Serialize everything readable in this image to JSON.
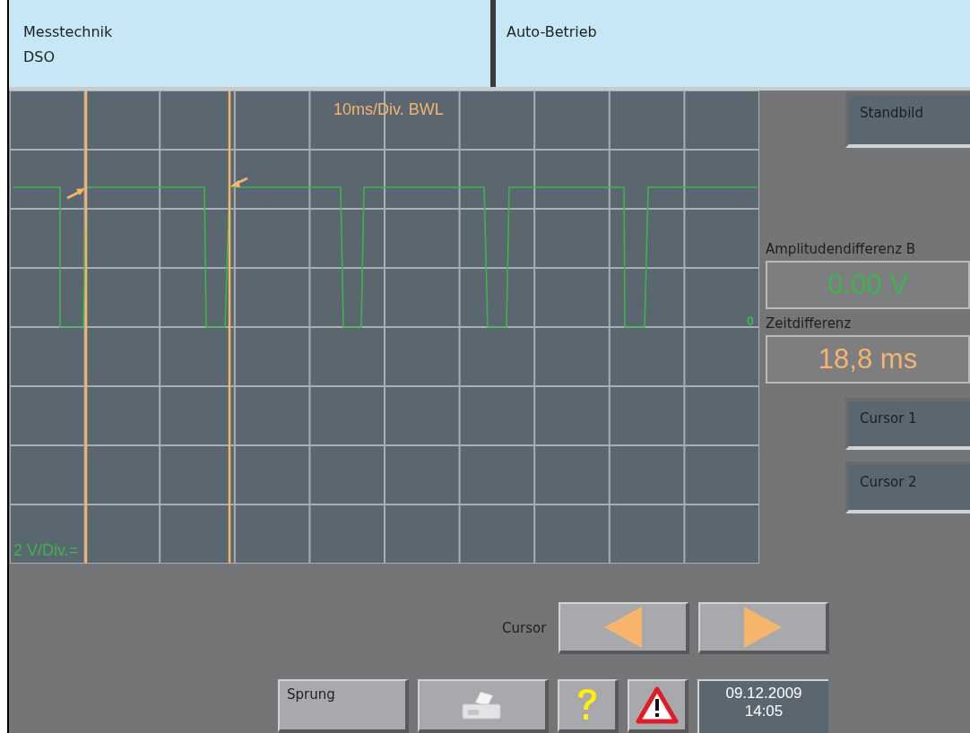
{
  "header": {
    "area": "Messtechnik",
    "mode": "DSO",
    "operation": "Auto-Betrieb"
  },
  "scope": {
    "timebase": "10ms/Div. BWL",
    "vertical_scale": "2 V/Div.=",
    "zero_marker": "0"
  },
  "side_buttons": [
    {
      "label": "Standbild"
    }
  ],
  "measurements": [
    {
      "label": "Amplitudendifferenz B",
      "value": "0.00 V",
      "color": "#3cb64a"
    },
    {
      "label": "Zeitdifferenz",
      "value": "18,8 ms",
      "color": "#f7b56b"
    }
  ],
  "cursor_buttons": [
    {
      "label": "Cursor 1"
    },
    {
      "label": "Cursor 2"
    }
  ],
  "cursor_control": {
    "label": "Cursor"
  },
  "bottom_bar": {
    "jump_button": "Sprung",
    "date": "09.12.2009",
    "time": "14:05"
  }
}
